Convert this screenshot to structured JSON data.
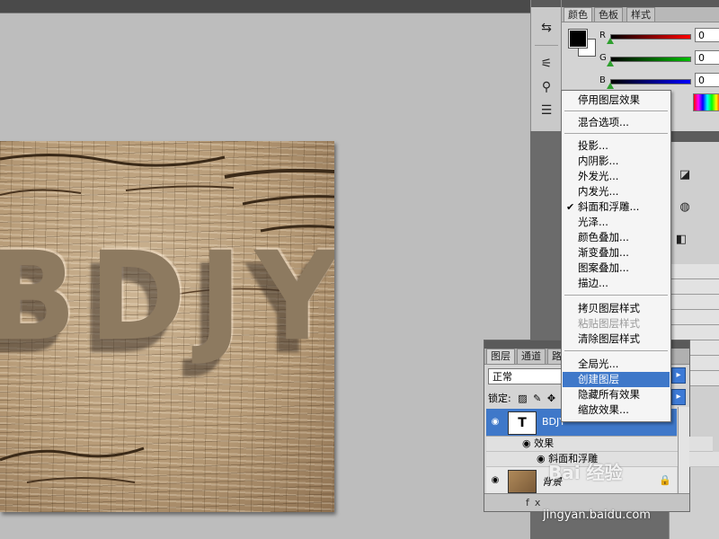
{
  "canvas": {
    "text": "BDJY"
  },
  "color_panel": {
    "tabs": [
      "颜色",
      "色板",
      "样式"
    ],
    "channels": [
      {
        "label": "R",
        "value": "0"
      },
      {
        "label": "G",
        "value": "0"
      },
      {
        "label": "B",
        "value": "0"
      }
    ]
  },
  "context_menu": {
    "items": [
      {
        "label": "停用图层效果"
      },
      {
        "label": "混合选项..."
      },
      {
        "label": "投影..."
      },
      {
        "label": "内阴影..."
      },
      {
        "label": "外发光..."
      },
      {
        "label": "内发光..."
      },
      {
        "label": "斜面和浮雕...",
        "checked": true
      },
      {
        "label": "光泽..."
      },
      {
        "label": "颜色叠加..."
      },
      {
        "label": "渐变叠加..."
      },
      {
        "label": "图案叠加..."
      },
      {
        "label": "描边..."
      },
      {
        "label": "拷贝图层样式"
      },
      {
        "label": "粘贴图层样式",
        "disabled": true
      },
      {
        "label": "清除图层样式"
      },
      {
        "label": "全局光..."
      },
      {
        "label": "创建图层",
        "highlighted": true
      },
      {
        "label": "隐藏所有效果"
      },
      {
        "label": "缩放效果..."
      }
    ],
    "check_mark": "✔"
  },
  "layers_panel": {
    "tabs": [
      "图层",
      "通道",
      "路"
    ],
    "blend_mode": "正常",
    "lock_label": "锁定:",
    "layers": [
      {
        "name": "BDJY",
        "thumb": "T",
        "selected": true
      },
      {
        "name": "背景"
      }
    ],
    "effects_label": "效果",
    "effect_item": "斜面和浮雕",
    "footer": "fx"
  },
  "watermark": {
    "logo": "Bai 经验",
    "url": "jingyan.baidu.com"
  }
}
